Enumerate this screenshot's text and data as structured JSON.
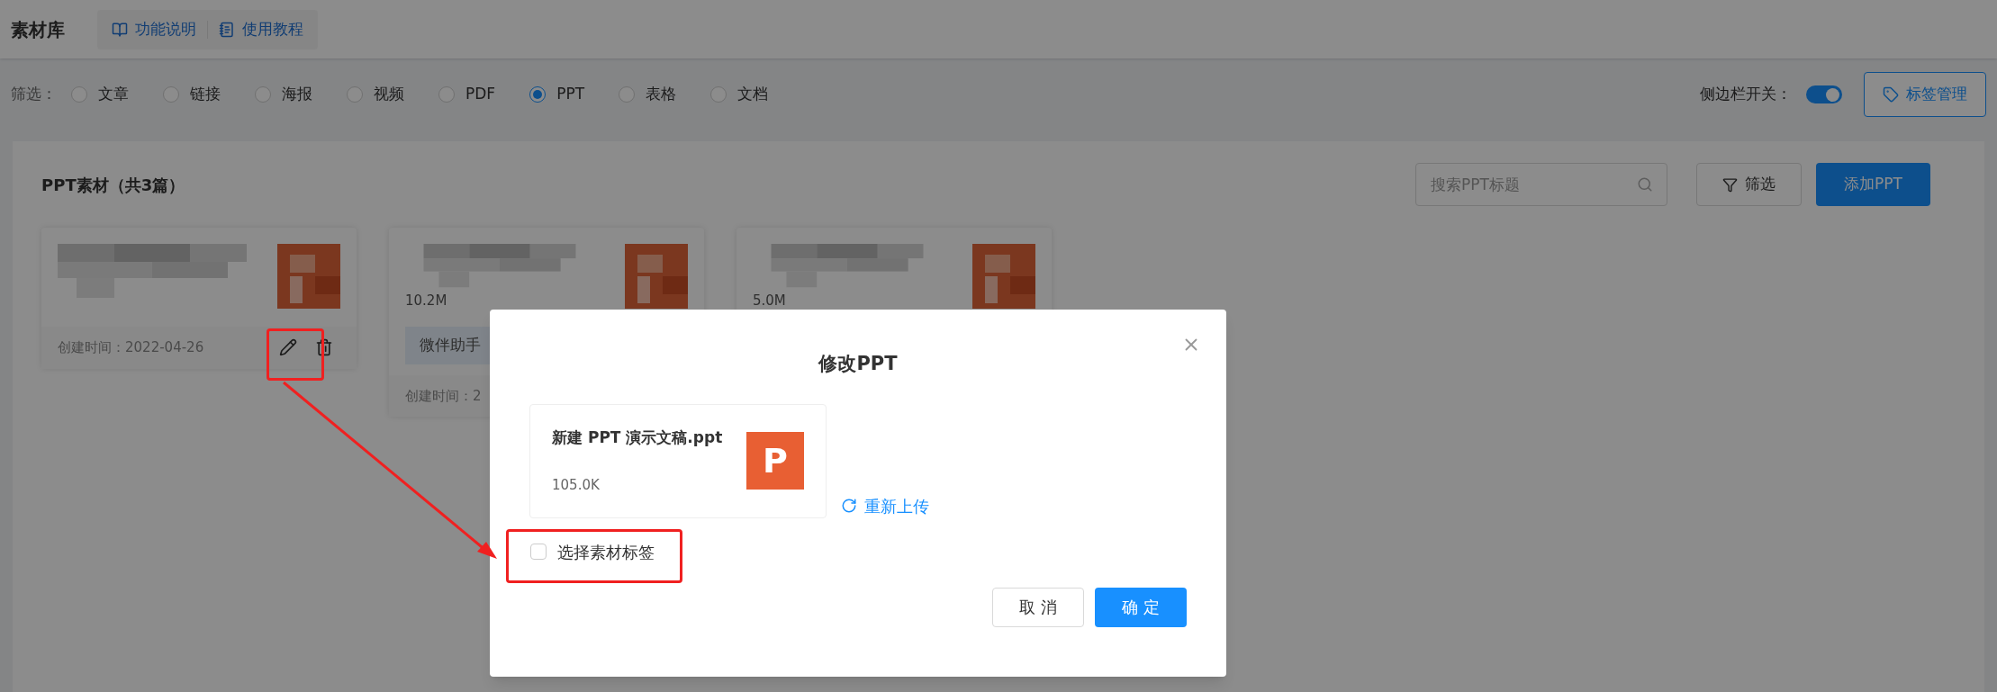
{
  "header": {
    "title": "素材库",
    "links": [
      {
        "label": "功能说明"
      },
      {
        "label": "使用教程"
      }
    ]
  },
  "filter": {
    "label": "筛选：",
    "options": [
      {
        "label": "文章",
        "selected": false
      },
      {
        "label": "链接",
        "selected": false
      },
      {
        "label": "海报",
        "selected": false
      },
      {
        "label": "视频",
        "selected": false
      },
      {
        "label": "PDF",
        "selected": false
      },
      {
        "label": "PPT",
        "selected": true
      },
      {
        "label": "表格",
        "selected": false
      },
      {
        "label": "文档",
        "selected": false
      }
    ]
  },
  "sidebar_toggle": {
    "label": "侧边栏开关：",
    "on": true
  },
  "tag_manage_button": "标签管理",
  "panel": {
    "title": "PPT素材（共3篇）",
    "search": {
      "placeholder": "搜索PPT标题"
    },
    "filter_button": "筛选",
    "add_button": "添加PPT",
    "cards": [
      {
        "created": "创建时间：2022-04-26"
      },
      {
        "size": "10.2M",
        "tag": "微伴助手",
        "created": "创建时间：2"
      },
      {
        "size": "5.0M"
      }
    ]
  },
  "modal": {
    "title": "修改PPT",
    "file": {
      "name": "新建 PPT 演示文稿.ppt",
      "size": "105.0K",
      "icon_letter": "P"
    },
    "reupload": "重新上传",
    "tag_checkbox": {
      "label": "选择素材标签",
      "checked": false
    },
    "cancel": "取 消",
    "ok": "确 定"
  }
}
